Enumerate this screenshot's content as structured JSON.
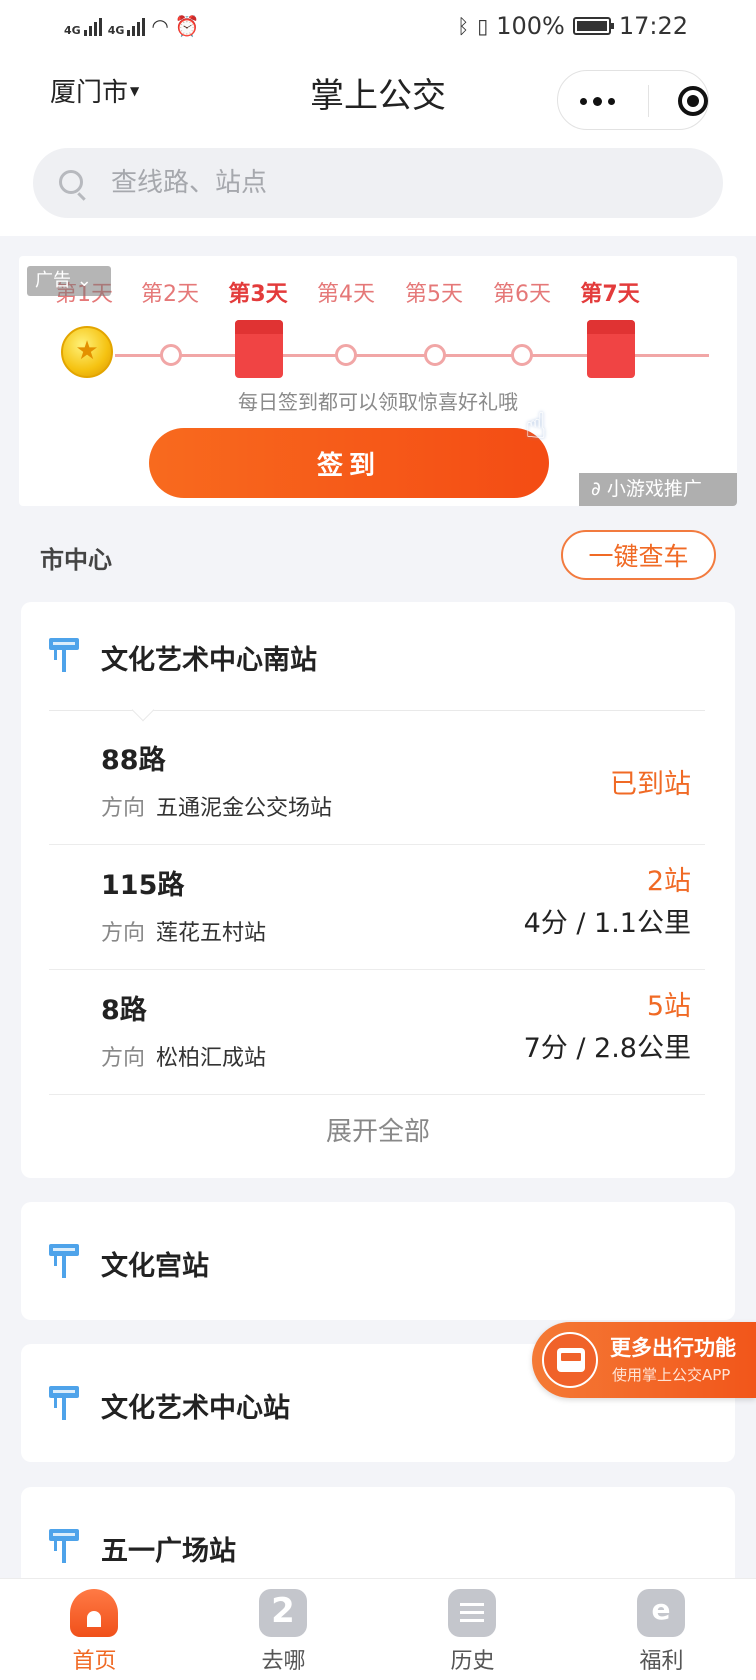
{
  "status_bar": {
    "net1": "4G",
    "net2": "4G",
    "battery": "100%",
    "time": "17:22"
  },
  "header": {
    "city": "厦门市",
    "title": "掌上公交"
  },
  "search": {
    "placeholder": "查线路、站点"
  },
  "ad": {
    "tag": "广告",
    "days": [
      "第1天",
      "第2天",
      "第3天",
      "第4天",
      "第5天",
      "第6天",
      "第7天"
    ],
    "description": "每日签到都可以领取惊喜好礼哦",
    "button": "签到",
    "promo": "小游戏推广"
  },
  "section": {
    "title": "市中心",
    "quick_button": "一键查车"
  },
  "stations": [
    {
      "name": "文化艺术中心南站",
      "routes": [
        {
          "name": "88路",
          "dir_label": "方向",
          "direction": "五通泥金公交场站",
          "status": "已到站"
        },
        {
          "name": "115路",
          "dir_label": "方向",
          "direction": "莲花五村站",
          "stops": "2站",
          "eta": "4分 / 1.1公里"
        },
        {
          "name": "8路",
          "dir_label": "方向",
          "direction": "松柏汇成站",
          "stops": "5站",
          "eta": "7分 / 2.8公里"
        }
      ],
      "expand": "展开全部"
    },
    {
      "name": "文化宫站"
    },
    {
      "name": "文化艺术中心站"
    },
    {
      "name": "五一广场站"
    }
  ],
  "float_promo": {
    "title": "更多出行功能",
    "subtitle": "使用掌上公交APP"
  },
  "tabs": [
    {
      "label": "首页",
      "icon": "home-icon"
    },
    {
      "label": "去哪",
      "icon": "route-icon"
    },
    {
      "label": "历史",
      "icon": "history-icon"
    },
    {
      "label": "福利",
      "icon": "gift-icon"
    }
  ],
  "colors": {
    "accent": "#f06a25",
    "stop_icon": "#4ea3ea"
  }
}
